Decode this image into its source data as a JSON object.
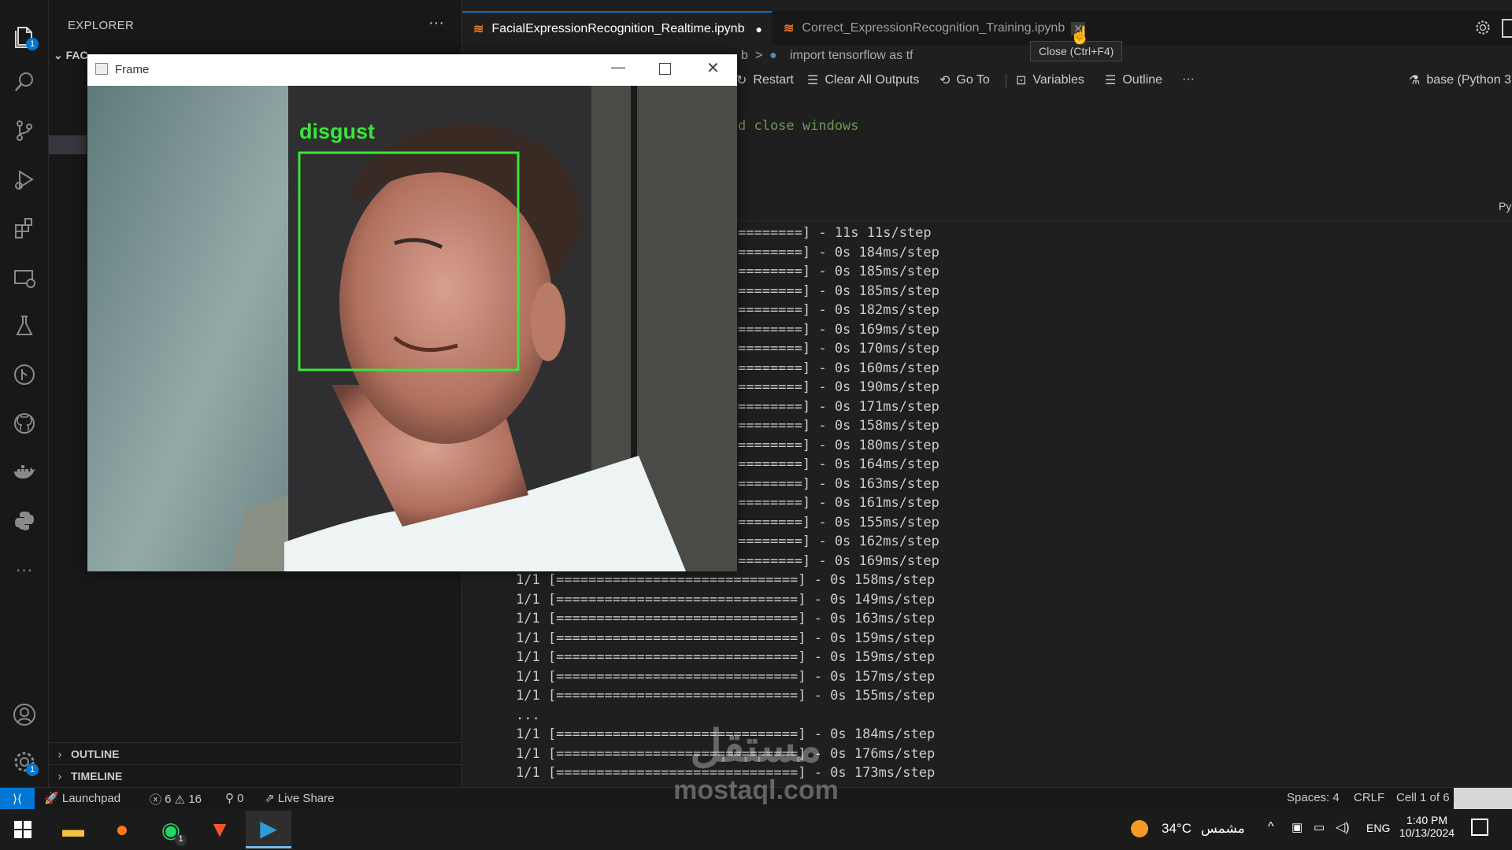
{
  "sidebar": {
    "title": "EXPLORER",
    "more": "···",
    "folder_label": "FAC",
    "sections": [
      {
        "label": "OUTLINE"
      },
      {
        "label": "TIMELINE"
      }
    ]
  },
  "activity_badges": {
    "explorer": "1",
    "settings": "1"
  },
  "tabs": [
    {
      "label": "FacialExpressionRecognition_Realtime.ipynb",
      "modified": "●",
      "icon": "jupyter-icon"
    },
    {
      "label": "Correct_ExpressionRecognition_Training.ipynb",
      "close": "✕",
      "icon": "jupyter-icon"
    }
  ],
  "tooltip": "Close (Ctrl+F4)",
  "breadcrumbs": {
    "file_tail": "b",
    "separator": ">",
    "cell": "import tensorflow as tf"
  },
  "toolbar": {
    "restart": "Restart",
    "clear_outputs": "Clear All Outputs",
    "goto": "Go To",
    "variables": "Variables",
    "outline": "Outline",
    "more": "···",
    "kernel": "base (Python 3"
  },
  "editor": {
    "comment_fragment": "d close windows",
    "lang_marker": "Py"
  },
  "output_lines": [
    "========] - 11s 11s/step",
    "========] - 0s 184ms/step",
    "========] - 0s 185ms/step",
    "========] - 0s 185ms/step",
    "========] - 0s 182ms/step",
    "========] - 0s 169ms/step",
    "========] - 0s 170ms/step",
    "========] - 0s 160ms/step",
    "========] - 0s 190ms/step",
    "========] - 0s 171ms/step",
    "========] - 0s 158ms/step",
    "========] - 0s 180ms/step",
    "========] - 0s 164ms/step",
    "========] - 0s 163ms/step",
    "========] - 0s 161ms/step",
    "========] - 0s 155ms/step",
    "========] - 0s 162ms/step",
    "========] - 0s 169ms/step",
    "1/1 [==============================] - 0s 158ms/step",
    "1/1 [==============================] - 0s 149ms/step",
    "1/1 [==============================] - 0s 163ms/step",
    "1/1 [==============================] - 0s 159ms/step",
    "1/1 [==============================] - 0s 159ms/step",
    "1/1 [==============================] - 0s 157ms/step",
    "1/1 [==============================] - 0s 155ms/step",
    "...",
    "1/1 [==============================] - 0s 184ms/step",
    "1/1 [==============================] - 0s 176ms/step",
    "1/1 [==============================] - 0s 173ms/step"
  ],
  "frame_window": {
    "title": "Frame",
    "detection_label": "disgust",
    "box_color": "#39e639"
  },
  "statusbar": {
    "launchpad": "Launchpad",
    "errors": "6",
    "warnings": "16",
    "ports": "0",
    "live_share": "Live Share",
    "spaces": "Spaces: 4",
    "eol": "CRLF",
    "cell": "Cell 1 of 6"
  },
  "taskbar": {
    "whatsapp_badge": "1",
    "weather_temp": "34°C",
    "weather_text": "مشمس",
    "language": "ENG",
    "time": "1:40 PM",
    "date": "10/13/2024"
  },
  "watermark": {
    "arabic": "مستقل",
    "latin": "mostaql.com"
  },
  "colors": {
    "accent": "#0078d4",
    "jupyter": "#f37726",
    "box": "#39e639"
  }
}
